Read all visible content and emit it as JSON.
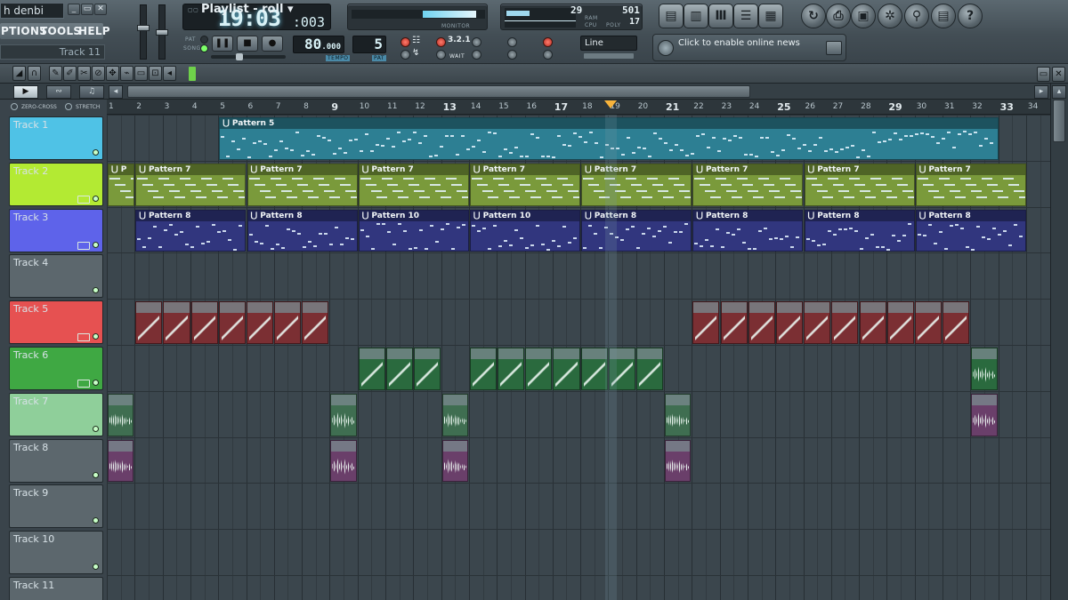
{
  "app": {
    "project_title": "h denbi",
    "window_buttons": [
      "_",
      "▭",
      "✕"
    ],
    "menu": [
      "PTIONS",
      "TOOLS",
      "HELP"
    ],
    "hint_text": "Track 11"
  },
  "transport": {
    "time_main": "19:03",
    "time_frac": ":003",
    "pat_label": "PAT",
    "song_label": "SONG",
    "tempo_value": "80",
    "tempo_frac": ".000",
    "tempo_label": "TEMPO",
    "pattern_value": "5",
    "pattern_label": "PAT",
    "cpu_value": "29",
    "ram_value": "501",
    "poly_value": "17",
    "ram_label": "RAM",
    "cpu_label": "CPU",
    "poly_label": "POLY",
    "monitor_label": "MONITOR",
    "snap_select": "Line",
    "rec_labels": [
      "3.2.1",
      "WAIT"
    ]
  },
  "news": {
    "text": "Click to enable online news"
  },
  "playlist": {
    "title": "Playlist - roll",
    "title_arrow": "▾",
    "zero_cross": "ZERO-CROSS",
    "stretch": "STRETCH",
    "bars": [
      "1",
      "2",
      "3",
      "4",
      "5",
      "6",
      "7",
      "8",
      "9",
      "10",
      "11",
      "12",
      "13",
      "14",
      "15",
      "16",
      "17",
      "18",
      "19",
      "20",
      "21",
      "22",
      "23",
      "24",
      "25",
      "26",
      "27",
      "28",
      "29",
      "30",
      "31",
      "32",
      "33",
      "34"
    ]
  },
  "tracks": [
    {
      "label": "Track 1",
      "color": "#4fc2e6"
    },
    {
      "label": "Track 2",
      "color": "#b3ea33"
    },
    {
      "label": "Track 3",
      "color": "#5e63ea"
    },
    {
      "label": "Track 4",
      "color": "#5c676d"
    },
    {
      "label": "Track 5",
      "color": "#e65151"
    },
    {
      "label": "Track 6",
      "color": "#3fa843"
    },
    {
      "label": "Track 7",
      "color": "#8fcf9a"
    },
    {
      "label": "Track 8",
      "color": "#5c676d"
    },
    {
      "label": "Track 9",
      "color": "#5c676d"
    },
    {
      "label": "Track 10",
      "color": "#5c676d"
    },
    {
      "label": "Track 11",
      "color": "#5c676d"
    }
  ],
  "clips": [
    {
      "track": 1,
      "name": "Pattern 5",
      "start": 5,
      "end": 33,
      "kind": "notes",
      "color": "#2d7f93"
    },
    {
      "track": 2,
      "name": "",
      "start": 1,
      "end": 2,
      "kind": "notes",
      "color": "#7a9a3b"
    },
    {
      "track": 2,
      "name": "Pattern 7",
      "start": 2,
      "end": 6,
      "kind": "notes",
      "color": "#7a9a3b"
    },
    {
      "track": 2,
      "name": "Pattern 7",
      "start": 6,
      "end": 10,
      "kind": "notes",
      "color": "#7a9a3b"
    },
    {
      "track": 2,
      "name": "Pattern 7",
      "start": 10,
      "end": 14,
      "kind": "notes",
      "color": "#7a9a3b"
    },
    {
      "track": 2,
      "name": "Pattern 7",
      "start": 14,
      "end": 18,
      "kind": "notes",
      "color": "#7a9a3b"
    },
    {
      "track": 2,
      "name": "Pattern 7",
      "start": 18,
      "end": 22,
      "kind": "notes",
      "color": "#7a9a3b"
    },
    {
      "track": 2,
      "name": "Pattern 7",
      "start": 22,
      "end": 26,
      "kind": "notes",
      "color": "#7a9a3b"
    },
    {
      "track": 2,
      "name": "Pattern 7",
      "start": 26,
      "end": 30,
      "kind": "notes",
      "color": "#7a9a3b"
    },
    {
      "track": 2,
      "name": "Pattern 7",
      "start": 30,
      "end": 34,
      "kind": "notes",
      "color": "#7a9a3b"
    },
    {
      "track": 3,
      "name": "Pattern 8",
      "start": 2,
      "end": 6,
      "kind": "notes",
      "color": "#31367e"
    },
    {
      "track": 3,
      "name": "Pattern 8",
      "start": 6,
      "end": 10,
      "kind": "notes",
      "color": "#31367e"
    },
    {
      "track": 3,
      "name": "Pattern 10",
      "start": 10,
      "end": 14,
      "kind": "notes",
      "color": "#31367e"
    },
    {
      "track": 3,
      "name": "Pattern 10",
      "start": 14,
      "end": 18,
      "kind": "notes",
      "color": "#31367e"
    },
    {
      "track": 3,
      "name": "Pattern 8",
      "start": 18,
      "end": 22,
      "kind": "notes",
      "color": "#31367e"
    },
    {
      "track": 3,
      "name": "Pattern 8",
      "start": 22,
      "end": 26,
      "kind": "notes",
      "color": "#31367e"
    },
    {
      "track": 3,
      "name": "Pattern 8",
      "start": 26,
      "end": 30,
      "kind": "notes",
      "color": "#31367e"
    },
    {
      "track": 3,
      "name": "Pattern 8",
      "start": 30,
      "end": 34,
      "kind": "notes",
      "color": "#31367e"
    },
    {
      "track": 5,
      "name": "",
      "start": 2,
      "end": 9,
      "kind": "diag",
      "color": "#7b2f33",
      "count": 7
    },
    {
      "track": 5,
      "name": "",
      "start": 22,
      "end": 32,
      "kind": "diag",
      "color": "#7b2f33",
      "count": 10
    },
    {
      "track": 6,
      "name": "",
      "start": 10,
      "end": 13,
      "kind": "diag",
      "color": "#2a6a3e",
      "count": 3
    },
    {
      "track": 6,
      "name": "",
      "start": 14,
      "end": 21,
      "kind": "diag",
      "color": "#2a6a3e",
      "count": 7
    },
    {
      "track": 6,
      "name": "",
      "start": 32,
      "end": 33,
      "kind": "wave",
      "color": "#2a6a3e",
      "count": 1
    },
    {
      "track": 7,
      "name": "",
      "start": 1,
      "end": 2,
      "kind": "wave",
      "color": "#3f6e51",
      "count": 1
    },
    {
      "track": 7,
      "name": "",
      "start": 9,
      "end": 10,
      "kind": "wave",
      "color": "#3f6e51",
      "count": 1
    },
    {
      "track": 7,
      "name": "",
      "start": 13,
      "end": 14,
      "kind": "wave",
      "color": "#3f6e51",
      "count": 1
    },
    {
      "track": 7,
      "name": "",
      "start": 21,
      "end": 22,
      "kind": "wave",
      "color": "#3f6e51",
      "count": 1
    },
    {
      "track": 7,
      "name": "",
      "start": 32,
      "end": 33,
      "kind": "wave",
      "color": "#6a3f6a",
      "count": 1
    },
    {
      "track": 8,
      "name": "",
      "start": 1,
      "end": 2,
      "kind": "wave",
      "color": "#6a3f6a",
      "count": 1
    },
    {
      "track": 8,
      "name": "",
      "start": 9,
      "end": 10,
      "kind": "wave",
      "color": "#6a3f6a",
      "count": 1
    },
    {
      "track": 8,
      "name": "",
      "start": 13,
      "end": 14,
      "kind": "wave",
      "color": "#6a3f6a",
      "count": 1
    },
    {
      "track": 8,
      "name": "",
      "start": 21,
      "end": 22,
      "kind": "wave",
      "color": "#6a3f6a",
      "count": 1
    }
  ],
  "playhead_bar": 18.9,
  "toolbar_icons": [
    "mixer-icon",
    "channel-rack-icon",
    "piano-roll-icon",
    "browser-icon",
    "playlist-icon",
    "undo-icon",
    "save-icon",
    "export-icon",
    "plugin-icon",
    "tools-icon",
    "info-icon",
    "help-icon"
  ]
}
